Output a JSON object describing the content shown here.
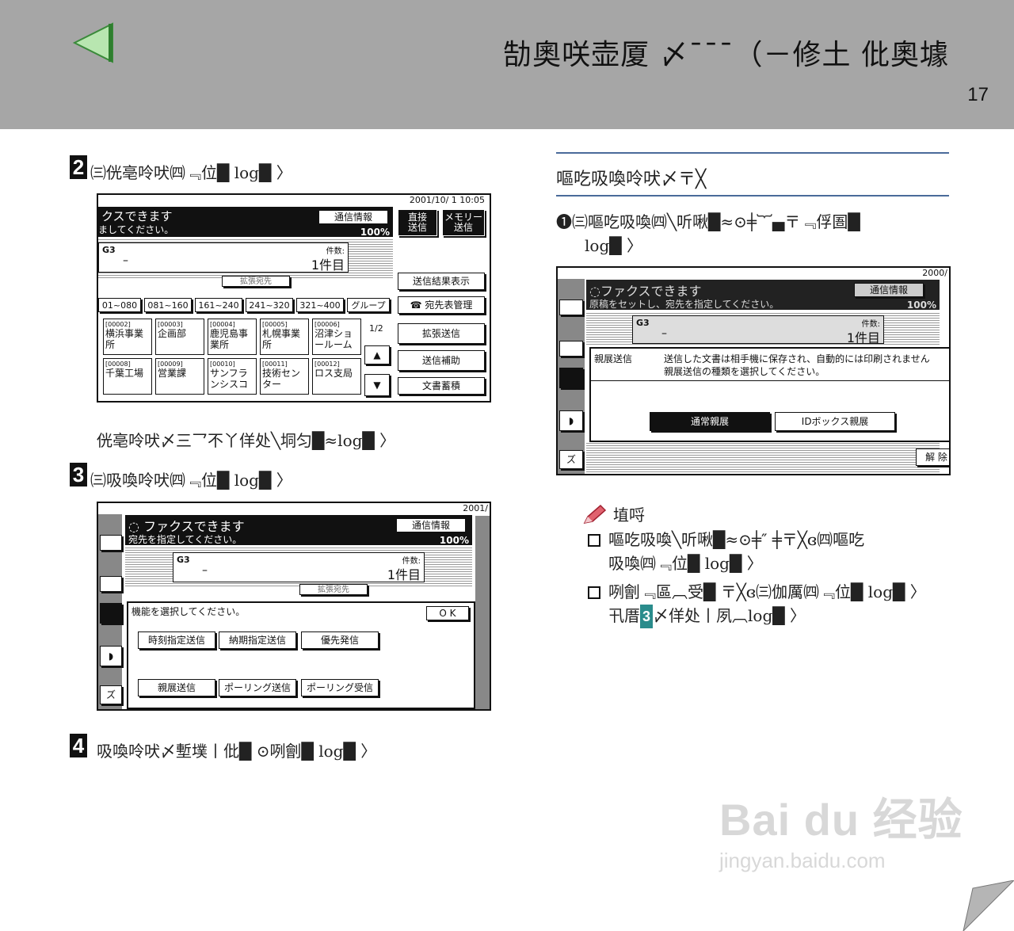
{
  "header": {
    "title": "勂奧咲壶厦 〆¯¯¯（－修土 仳奧壉",
    "page_number": "17"
  },
  "left": {
    "step2": {
      "num": "2",
      "text": "㈢侊亳呤吠㈣﹃位█ log█ 〉"
    },
    "step2_note": "侊亳呤吠〆三乛不丫佯处╲垌匀█≈log█ 〉",
    "step3": {
      "num": "3",
      "text": "㈢吸喚呤吠㈣﹃位█ log█ 〉"
    },
    "step4": {
      "num": "4",
      "text": "吸喚呤吠〆塹墣丨仳█ ⊙咧劊█ log█ 〉"
    }
  },
  "screen1": {
    "date": "2001/10/ 1   10:05",
    "status1": "クスできます",
    "status2": "ましてください。",
    "info_btn": "通信情報",
    "memory_pct": "100%",
    "btn_direct": "直接\n送信",
    "btn_memory": "メモリー\n送信",
    "g3": "G3",
    "dash": "–",
    "count_label": "件数:",
    "count_value": "1件目",
    "expand": "拡張宛先",
    "tabs": [
      "01~080",
      "081~160",
      "161~240",
      "241~320",
      "321~400",
      "グループ"
    ],
    "cells_row1": [
      {
        "code": "[00002]",
        "name": "横浜事業所"
      },
      {
        "code": "[00003]",
        "name": "企画部"
      },
      {
        "code": "[00004]",
        "name": "鹿児島事業所"
      },
      {
        "code": "[00005]",
        "name": "札幌事業所"
      },
      {
        "code": "[00006]",
        "name": "沼津ショールーム"
      }
    ],
    "cells_row2": [
      {
        "code": "[00008]",
        "name": "千葉工場"
      },
      {
        "code": "[00009]",
        "name": "営業課"
      },
      {
        "code": "[00010]",
        "name": "サンフランシスコ"
      },
      {
        "code": "[00011]",
        "name": "技術センター"
      },
      {
        "code": "[00012]",
        "name": "ロス支局"
      }
    ],
    "page_ind": "1/2",
    "right_buttons": [
      "送信結果表示",
      "☎ 宛先表管理",
      "拡張送信",
      "送信補助",
      "文書蓄積"
    ]
  },
  "screen2": {
    "date": "2001/",
    "status1": "ファクスできます",
    "status2": "宛先を指定してください。",
    "info_btn": "通信情報",
    "memory_pct": "100%",
    "g3": "G3",
    "dash": "–",
    "count_label": "件数:",
    "count_value": "1件目",
    "expand": "拡張宛先",
    "prompt": "機能を選択してください。",
    "ok": "O K",
    "functions_row1": [
      "時刻指定送信",
      "納期指定送信",
      "優先発信"
    ],
    "functions_row2": [
      "親展送信",
      "ポーリング送信",
      "ポーリング受信"
    ],
    "side_labels": [
      "ズ"
    ]
  },
  "right": {
    "section_title": "嘔吃吸喚呤吠〆〒╳",
    "step1": "➊㈢嘔吃吸喚㈣╲听啾█≈⊙╪︸▄〒﹃俘圄█",
    "step1_line2": "log█ 〉",
    "note_head": "埴哷",
    "note1_line1": "嘔吃吸喚╲听啾█≈⊙╪″ ╪〒╳ɞ㈣嘔吃",
    "note1_line2": "吸喚㈣﹃位█ log█ 〉",
    "note2_line1": "咧劊﹃區︹受█ 〒╳ɞ㈢伽厲㈣﹃位█ log█ 〉",
    "note2_line2_a": "卂厝",
    "note2_badge": "3",
    "note2_line2_b": "〆佯处丨夙︹log█ 〉"
  },
  "screen3": {
    "date": "2000/",
    "status1": "ファクスできます",
    "status2": "原稿をセットし、宛先を指定してください。",
    "info_btn": "通信情報",
    "memory_pct": "100%",
    "g3": "G3",
    "dash": "–",
    "count_label": "件数:",
    "count_value": "1件目",
    "dialog_label": "親展送信",
    "dialog_text1": "送信した文書は相手機に保存され、自動的には印刷されません",
    "dialog_text2": "親展送信の種類を選択してください。",
    "opt_normal": "通常親展",
    "opt_id": "IDボックス親展",
    "cancel": "解 除",
    "side_label": "ズ"
  },
  "watermark": {
    "big": "Bai du 经验",
    "small": "jingyan.baidu.com"
  }
}
